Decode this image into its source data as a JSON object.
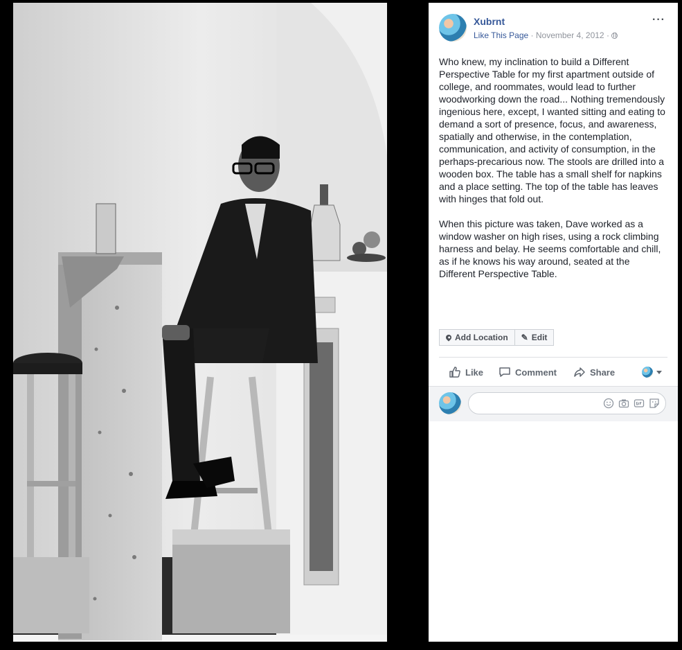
{
  "page": {
    "name": "Xubrnt",
    "like_page": "Like This Page",
    "separator": "·",
    "date": "November 4, 2012",
    "more": "···"
  },
  "post": {
    "paragraphs": [
      "Who knew, my inclination to build a Different Perspective Table for my first apartment outside of college, and roommates, would lead to further woodworking down the road... Nothing tremendously ingenious here, except, I wanted sitting and eating to demand a sort of presence, focus, and awareness, spatially and otherwise, in the contemplation, communication, and activity of consumption, in the perhaps-precarious now. The stools are drilled into a wooden box. The table has a small shelf for napkins and a place setting. The top of the table has leaves with hinges that fold out.",
      "When this picture was taken, Dave worked as a window washer on high rises, using a rock climbing harness and belay. He seems comfortable and chill, as if he knows his way around, seated at the Different Perspective Table."
    ]
  },
  "buttons": {
    "add_location": "Add Location",
    "edit": "Edit"
  },
  "actions": {
    "like": "Like",
    "comment": "Comment",
    "share": "Share"
  },
  "comment": {
    "value": "",
    "placeholder": ""
  },
  "icons": [
    "globe-icon",
    "more-icon",
    "pin-icon",
    "pencil-icon",
    "thumbs-up-icon",
    "speech-bubble-icon",
    "share-arrow-icon",
    "caret-down-icon",
    "smiley-icon",
    "camera-icon",
    "gif-icon",
    "sticker-icon"
  ],
  "colors": {
    "link": "#365899",
    "meta": "#90949c",
    "text": "#1d2129",
    "action": "#606770",
    "panel_bg": "#ffffff",
    "stage_bg": "#000000"
  }
}
